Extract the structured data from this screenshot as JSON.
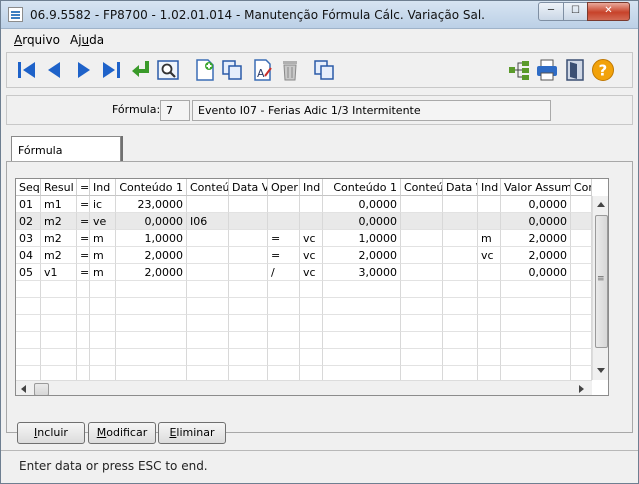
{
  "window": {
    "title": "06.9.5582 - FP8700 - 1.02.01.014 - Manutenção Fórmula Cálc. Variação Sal.",
    "min_glyph": "─",
    "max_glyph": "☐",
    "close_glyph": "✕"
  },
  "menu": {
    "arquivo": {
      "prefix": "",
      "key": "A",
      "rest": "rquivo"
    },
    "ajuda": {
      "prefix": "Aj",
      "key": "u",
      "rest": "da"
    }
  },
  "toolbar": {
    "icons": [
      "first-record-icon",
      "previous-record-icon",
      "next-record-icon",
      "last-record-icon",
      "enter-icon",
      "find-icon",
      "new-record-icon",
      "copy-record-icon",
      "edit-record-icon",
      "delete-icon",
      "duplicate-icon",
      "tree-icon",
      "print-icon",
      "exit-icon",
      "help-icon"
    ]
  },
  "form": {
    "label": "Fórmula:",
    "code": "7",
    "description": "Evento I07 - Ferias Adic 1/3 Intermitente"
  },
  "tab": {
    "label": "Fórmula"
  },
  "grid": {
    "headers": [
      "Seq",
      "Resul",
      "=",
      "Ind",
      "Conteúdo 1",
      "Conteúd",
      "Data Va",
      "Oper",
      "Ind",
      "Conteúdo 1",
      "Conteúd",
      "Data V",
      "Ind",
      "Valor Assumir",
      "Cor"
    ],
    "rows": [
      [
        "01",
        "m1",
        "=",
        "ic",
        "23,0000",
        "",
        "",
        "",
        "",
        "0,0000",
        "",
        "",
        "",
        "0,0000",
        ""
      ],
      [
        "02",
        "m2",
        "=",
        "ve",
        "0,0000",
        "I06",
        "",
        "",
        "",
        "0,0000",
        "",
        "",
        "",
        "0,0000",
        ""
      ],
      [
        "03",
        "m2",
        "=",
        "m",
        "1,0000",
        "",
        "",
        "=",
        "vc",
        "1,0000",
        "",
        "",
        "m",
        "2,0000",
        ""
      ],
      [
        "04",
        "m2",
        "=",
        "m",
        "2,0000",
        "",
        "",
        "=",
        "vc",
        "2,0000",
        "",
        "",
        "vc",
        "2,0000",
        ""
      ],
      [
        "05",
        "v1",
        "=",
        "m",
        "2,0000",
        "",
        "",
        "/",
        "vc",
        "3,0000",
        "",
        "",
        "",
        "0,0000",
        ""
      ]
    ],
    "selected_row": 1,
    "scroll_glyph": "≡"
  },
  "buttons": {
    "incluir": {
      "key": "I",
      "rest": "ncluir"
    },
    "modificar": {
      "key": "M",
      "rest": "odificar"
    },
    "eliminar": {
      "key": "E",
      "rest": "liminar"
    }
  },
  "status": {
    "text": "Enter data or press ESC to end."
  }
}
